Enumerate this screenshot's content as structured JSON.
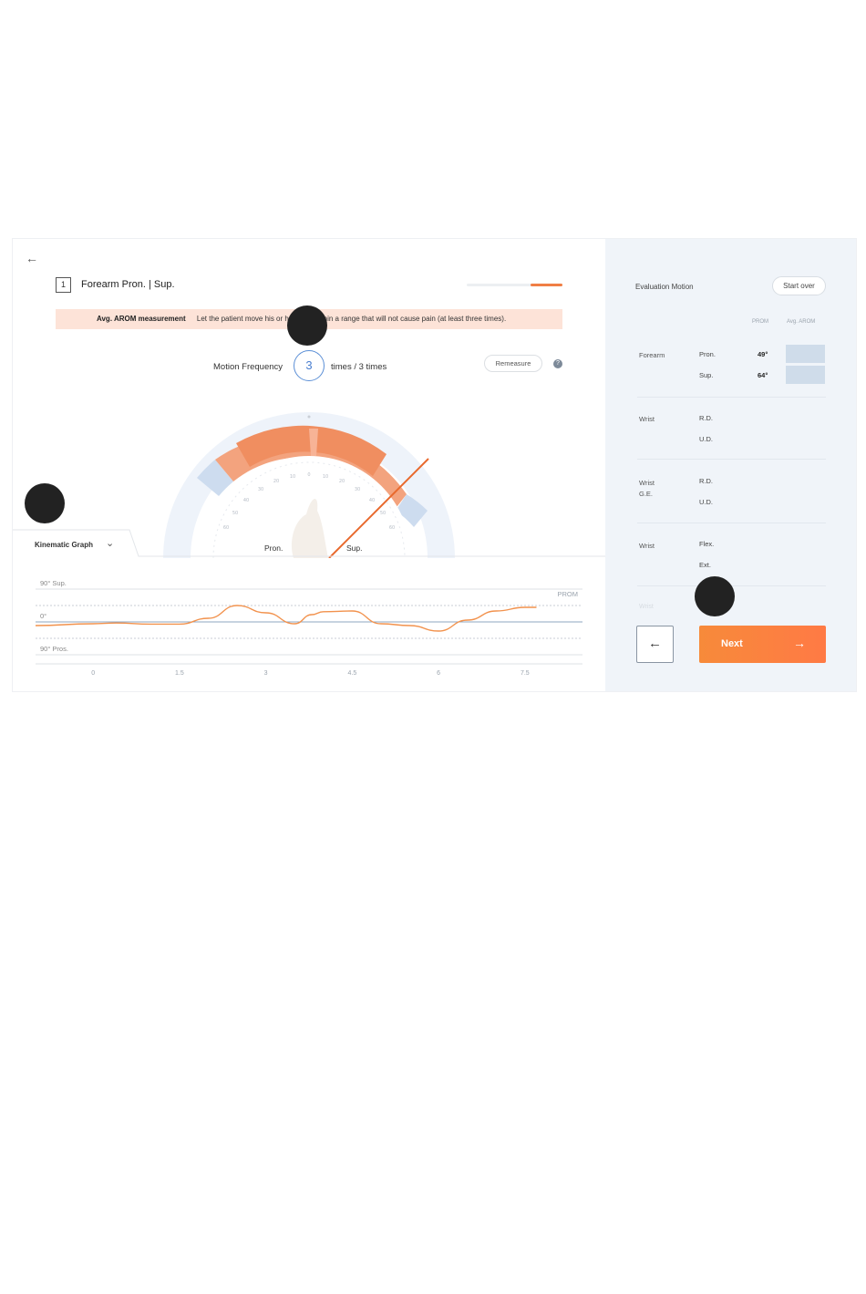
{
  "header": {
    "step_number": "1",
    "title": "Forearm  Pron. | Sup.",
    "progress_fraction": 0.33
  },
  "banner": {
    "label": "Avg. AROM measurement",
    "text": "Let the patient move his or her wrist within a range that will not cause pain (at least three times)."
  },
  "frequency": {
    "label": "Motion Frequency",
    "count": "3",
    "suffix": "times / 3 times",
    "remeasure_label": "Remeasure",
    "help_label": "?"
  },
  "gauge": {
    "left_label": "Pron.",
    "right_label": "Sup.",
    "ticks": [
      "0",
      "10",
      "20",
      "30",
      "40",
      "50",
      "60",
      "70",
      "80",
      "90"
    ]
  },
  "kinematic": {
    "tab_label": "Kinematic Graph",
    "y_labels": [
      "90° Sup.",
      "0°",
      "90° Pros."
    ],
    "series_label": "PROM",
    "x_ticks": [
      "0",
      "1.5",
      "3",
      "4.5",
      "6",
      "7.5"
    ]
  },
  "chart_data": {
    "type": "line",
    "title": "",
    "xlabel": "",
    "ylabel": "",
    "xlim": [
      -1,
      8.5
    ],
    "ylim": [
      -90,
      90
    ],
    "y_ticks": [
      90,
      0,
      -90
    ],
    "series": [
      {
        "name": "PROM",
        "color": "#f2924d",
        "x": [
          -1,
          0,
          0.4,
          1,
          1.5,
          2,
          2.5,
          3,
          3.5,
          3.8,
          4,
          4.5,
          5,
          5.5,
          6,
          6.5,
          7,
          7.5,
          7.7
        ],
        "y": [
          -10,
          -5,
          -3,
          -6,
          -6,
          10,
          45,
          25,
          -5,
          20,
          28,
          30,
          -5,
          -10,
          -25,
          5,
          30,
          40,
          40
        ]
      }
    ]
  },
  "right_panel": {
    "title": "Evaluation Motion",
    "start_over_label": "Start over",
    "col_prom": "PROM",
    "col_arom": "Avg. AROM",
    "sections": [
      {
        "name": "Forearm",
        "motions": [
          {
            "label": "Pron.",
            "prom": "49°"
          },
          {
            "label": "Sup.",
            "prom": "64°"
          }
        ]
      },
      {
        "name": "Wrist",
        "motions": [
          {
            "label": "R.D.",
            "prom": ""
          },
          {
            "label": "U.D.",
            "prom": ""
          }
        ]
      },
      {
        "name": "Wrist\nG.E.",
        "motions": [
          {
            "label": "R.D.",
            "prom": ""
          },
          {
            "label": "U.D.",
            "prom": ""
          }
        ]
      },
      {
        "name": "Wrist",
        "motions": [
          {
            "label": "Flex.",
            "prom": ""
          },
          {
            "label": "Ext.",
            "prom": ""
          }
        ]
      }
    ],
    "faded_label": "Wrist",
    "back_icon": "←",
    "next_label": "Next",
    "next_icon": "→"
  },
  "colors": {
    "accent": "#f07f45",
    "blue": "#5b8fd6",
    "panel_bg": "#f0f4f9"
  }
}
